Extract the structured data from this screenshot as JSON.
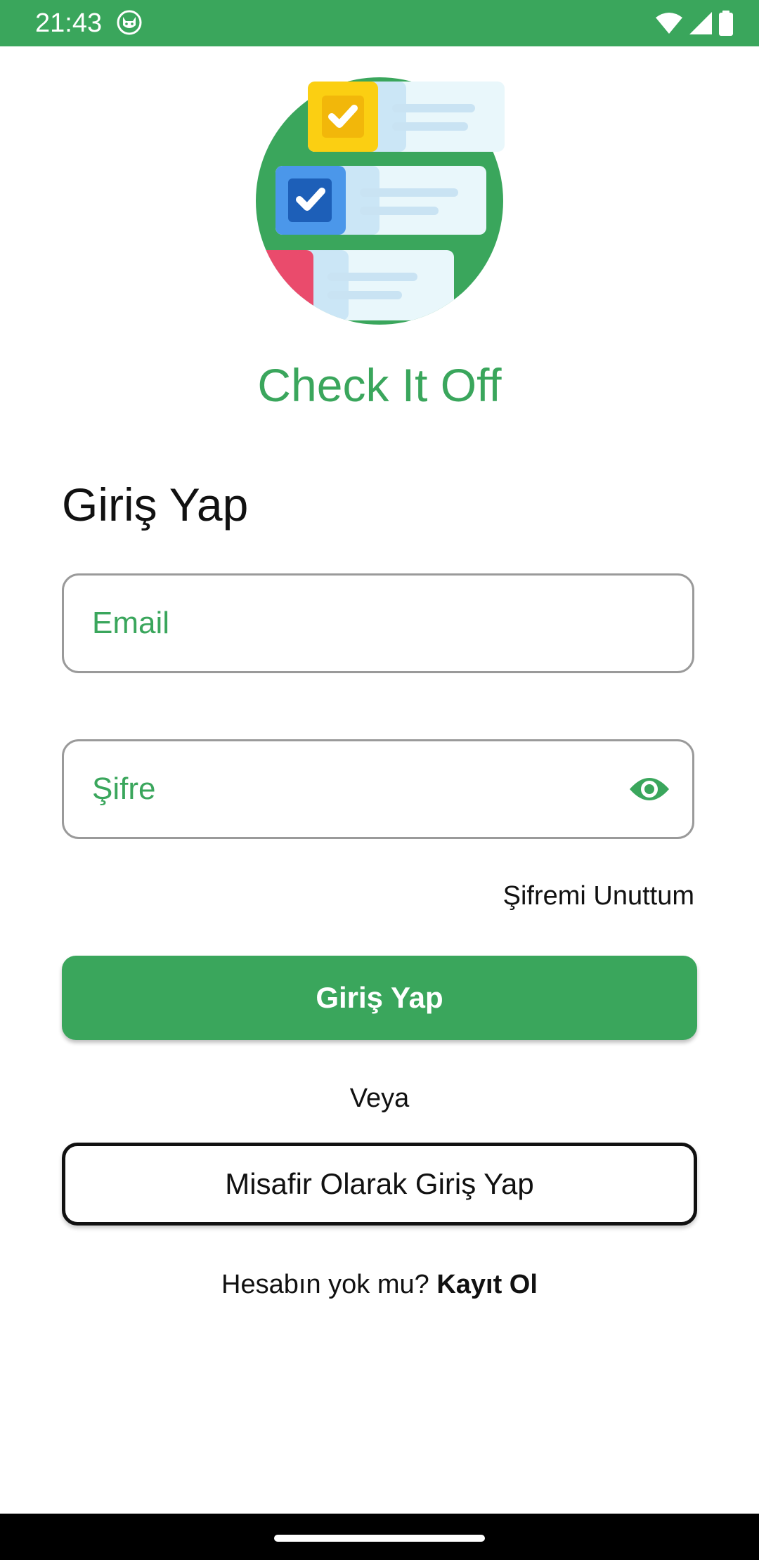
{
  "status_bar": {
    "time": "21:43",
    "icons": [
      "cat-notification-icon",
      "wifi-icon",
      "signal-icon",
      "battery-icon"
    ]
  },
  "app": {
    "logo_icon": "checklist-logo-icon",
    "name": "Check It Off"
  },
  "login": {
    "title": "Giriş Yap",
    "email_placeholder": "Email",
    "password_placeholder": "Şifre",
    "password_toggle_icon": "eye-icon",
    "forgot_password": "Şifremi Unuttum",
    "login_button": "Giriş Yap",
    "or_text": "Veya",
    "guest_button": "Misafir Olarak Giriş Yap",
    "no_account_text": "Hesabın yok mu?",
    "signup_link": "Kayıt Ol"
  },
  "colors": {
    "brand_green": "#3aa65c",
    "text_dark": "#111111",
    "field_border": "#9a9a9a"
  }
}
